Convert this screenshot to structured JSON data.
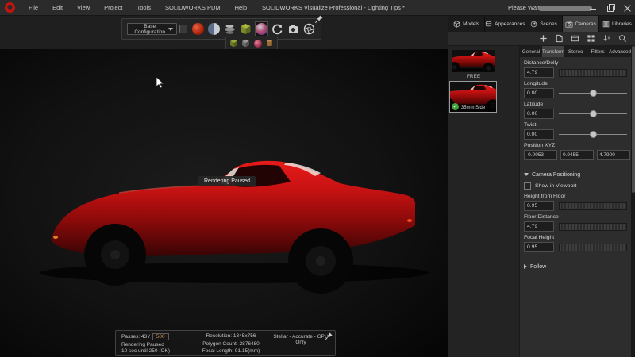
{
  "colors": {
    "car_red": "#c01010",
    "selected_tab_bg": "#414141",
    "passes_value_color": "#c8955c"
  },
  "titlebar": {
    "title": "SOLIDWORKS Visualize Professional - Lighting Tips *",
    "menus": [
      "File",
      "Edit",
      "View",
      "Project",
      "Tools",
      "SOLIDWORKS PDM",
      "Help"
    ],
    "status_text": "Please Wait"
  },
  "toolbar": {
    "config_label": "Base Configuration",
    "icons": [
      "render-mode-sphere",
      "split-render",
      "turntable",
      "models-cube",
      "appearances-sphere",
      "refresh-arrow",
      "camera-box",
      "aperture"
    ],
    "sub_icons": [
      "model-cube-green",
      "model-cube-gray",
      "appearance-sphere-red",
      "material-barrel"
    ]
  },
  "viewport": {
    "overlay_text": "Rendering Paused"
  },
  "status_box": {
    "passes_label": "Passes: 43 /",
    "passes_value": "500",
    "state": "Rendering Paused",
    "countdown": "10 sec until 250 (OK)",
    "resolution": "Resolution: 1345x756",
    "polygon_count": "Polygon Count: 2876480",
    "focal_length": "Focal Length: 91.15(mm)",
    "engine": "Stellar - Accurate - GPU Only"
  },
  "palette_tabs": {
    "models": "Models",
    "appearances": "Appearances",
    "scenes": "Scenes",
    "cameras": "Cameras",
    "libraries": "Libraries"
  },
  "cameras_panel": {
    "thumb1_label": "FREE",
    "thumb2_label": "35mm Side"
  },
  "properties": {
    "tabs": {
      "general": "General",
      "transform": "Transform",
      "stereo": "Stereo",
      "filters": "Filters",
      "advanced": "Advanced"
    },
    "selected_tab": "Transform",
    "fields": [
      {
        "label": "Distance/Dolly",
        "value": "4.79"
      },
      {
        "label": "Longitude",
        "value": "0.00"
      },
      {
        "label": "Latitude",
        "value": "0.00"
      },
      {
        "label": "Twist",
        "value": "0.00"
      }
    ],
    "position": {
      "label": "Position XYZ",
      "x": "-0.0053",
      "y": "0.9455",
      "z": "4.7900"
    },
    "camera_positioning": {
      "header": "Camera Positioning",
      "show_in_viewport": "Show in Viewport",
      "fields": [
        {
          "label": "Height from Floor",
          "value": "0.95"
        },
        {
          "label": "Floor Distance",
          "value": "4.79"
        },
        {
          "label": "Focal Height",
          "value": "0.95"
        }
      ]
    },
    "follow_header": "Follow"
  }
}
